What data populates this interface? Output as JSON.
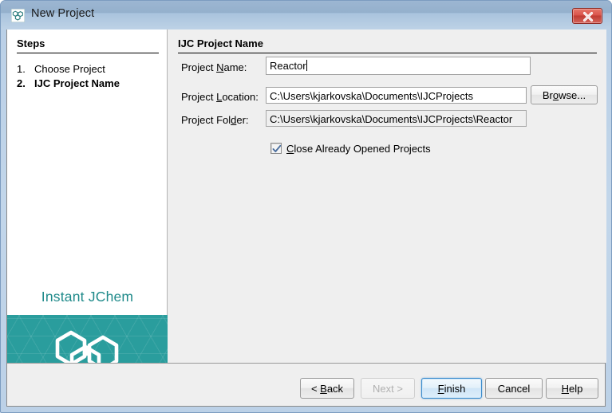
{
  "window": {
    "title": "New Project",
    "icon": "molecule-icon",
    "close_label": "Close",
    "frame_color": "#bcd1e7",
    "titlebar_top_color": "#94b0cc",
    "titlebar_bottom_color": "#bdd2e6",
    "close_button_color": "#c03a31"
  },
  "steps": {
    "heading": "Steps",
    "items": [
      {
        "number": "1.",
        "label": "Choose Project",
        "active": false
      },
      {
        "number": "2.",
        "label": "IJC Project Name",
        "active": true
      }
    ]
  },
  "branding": {
    "name": "Instant JChem",
    "name_color": "#1f8a8a",
    "panel_color": "#2a9d9d",
    "logo": "hexagon-molecule-logo"
  },
  "content": {
    "heading": "IJC Project Name",
    "fields": {
      "project_name": {
        "label_before": "Project ",
        "label_mnemonic": "N",
        "label_after": "ame:",
        "value": "Reactor"
      },
      "project_location": {
        "label_before": "Project ",
        "label_mnemonic": "L",
        "label_after": "ocation:",
        "value": "C:\\Users\\kjarkovska\\Documents\\IJCProjects"
      },
      "project_folder": {
        "label_before": "Project Fol",
        "label_mnemonic": "d",
        "label_after": "er:",
        "value": "C:\\Users\\kjarkovska\\Documents\\IJCProjects\\Reactor"
      }
    },
    "browse_button": {
      "before": "Br",
      "mnemonic": "o",
      "after": "wse..."
    },
    "checkbox": {
      "checked": true,
      "before": "",
      "mnemonic": "C",
      "after": "lose Already Opened Projects"
    }
  },
  "buttons": {
    "back": {
      "before": "< ",
      "mnemonic": "B",
      "after": "ack",
      "disabled": false,
      "default": false
    },
    "next": {
      "before": "",
      "mnemonic": "",
      "after": "Next >",
      "disabled": true,
      "default": false
    },
    "finish": {
      "before": "",
      "mnemonic": "F",
      "after": "inish",
      "disabled": false,
      "default": true
    },
    "cancel": {
      "before": "",
      "mnemonic": "",
      "after": "Cancel",
      "disabled": false,
      "default": false
    },
    "help": {
      "before": "",
      "mnemonic": "H",
      "after": "elp",
      "disabled": false,
      "default": false
    }
  }
}
